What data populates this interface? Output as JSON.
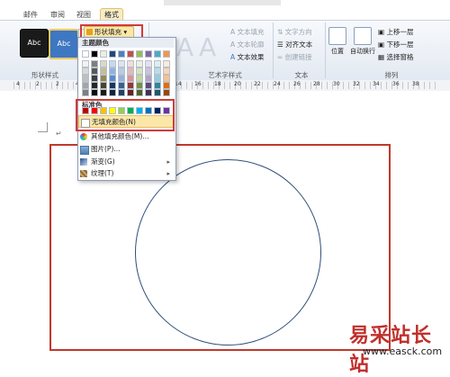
{
  "tabs": {
    "mail": "邮件",
    "review": "审阅",
    "view": "视图",
    "format": "格式"
  },
  "ribbon": {
    "style_a": "Abc",
    "style_b": "Abc",
    "shape_fill": "形状填充",
    "text_fill": "文本填充",
    "text_outline": "文本轮廓",
    "text_effects": "文本效果",
    "text_direction": "文字方向",
    "align_text": "对齐文本",
    "create_link": "创建链接",
    "position": "位置",
    "wrap_text": "自动换行",
    "bring_forward": "上移一层",
    "send_backward": "下移一层",
    "selection_pane": "选择窗格",
    "group_shape_styles": "形状样式",
    "group_wordart": "艺术字样式",
    "group_text": "文本",
    "group_arrange": "排列"
  },
  "dropdown": {
    "theme_colors_label": "主题颜色",
    "standard_colors_label": "标准色",
    "no_fill": "无填充颜色(N)",
    "more_colors": "其他填充颜色(M)...",
    "picture": "图片(P)...",
    "gradient": "渐变(G)",
    "texture": "纹理(T)"
  },
  "colors": {
    "theme_top": [
      "#ffffff",
      "#000000",
      "#eeece1",
      "#1f497d",
      "#4f81bd",
      "#c0504d",
      "#9bbb59",
      "#8064a2",
      "#4bacc6",
      "#f79646"
    ],
    "theme_shade": [
      [
        "#f2f2f2",
        "#7f7f7f",
        "#ddd9c3",
        "#c6d9f0",
        "#dbe5f1",
        "#f2dcdb",
        "#ebf1dd",
        "#e5e0ec",
        "#dbeef3",
        "#fdeada"
      ],
      [
        "#d8d8d8",
        "#595959",
        "#c4bd97",
        "#8db3e2",
        "#b8cce4",
        "#e5b9b7",
        "#d7e3bc",
        "#ccc1d9",
        "#b7dde8",
        "#fbd5b5"
      ],
      [
        "#bfbfbf",
        "#3f3f3f",
        "#938953",
        "#548dd4",
        "#95b3d7",
        "#d99694",
        "#c3d69b",
        "#b2a2c7",
        "#92cddc",
        "#fac08f"
      ],
      [
        "#a5a5a5",
        "#262626",
        "#494429",
        "#17365d",
        "#366092",
        "#953734",
        "#76923c",
        "#5f497a",
        "#31859b",
        "#e36c09"
      ],
      [
        "#7f7f7f",
        "#0c0c0c",
        "#1d1b10",
        "#0f243e",
        "#244061",
        "#632423",
        "#4f6128",
        "#3f3151",
        "#205867",
        "#974806"
      ]
    ],
    "standard": [
      "#c00000",
      "#ff0000",
      "#ffc000",
      "#ffff00",
      "#92d050",
      "#00b050",
      "#00b0f0",
      "#0070c0",
      "#002060",
      "#7030a0"
    ]
  },
  "ruler": {
    "numbers": [
      "4",
      "2",
      "2",
      "4",
      "6",
      "8",
      "10",
      "12",
      "14",
      "16",
      "18",
      "20",
      "22",
      "24",
      "26",
      "28",
      "30",
      "32",
      "34",
      "36",
      "38"
    ]
  },
  "watermark": {
    "title": "易采站长站",
    "url": "www.easck.com"
  }
}
